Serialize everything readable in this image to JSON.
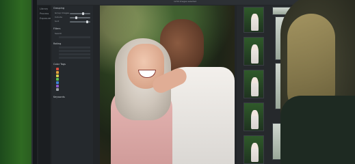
{
  "app": {
    "title_bar": "1234 Images selected"
  },
  "left_tabs": [
    "Library",
    "Process",
    "Exposure"
  ],
  "panel": {
    "sections": [
      "Grouping",
      "Filters",
      "Rating",
      "Color Tags",
      "Keywords"
    ],
    "items": [
      "Group Images",
      "Include",
      "Sort",
      "Search"
    ]
  },
  "colors": {
    "screen_bg": "#222528",
    "accent_tags": [
      "#d94b3d",
      "#e5a23a",
      "#d9cf4a",
      "#5cbf55",
      "#3f84d6",
      "#8b5ad0",
      "#9aa0a6"
    ]
  }
}
